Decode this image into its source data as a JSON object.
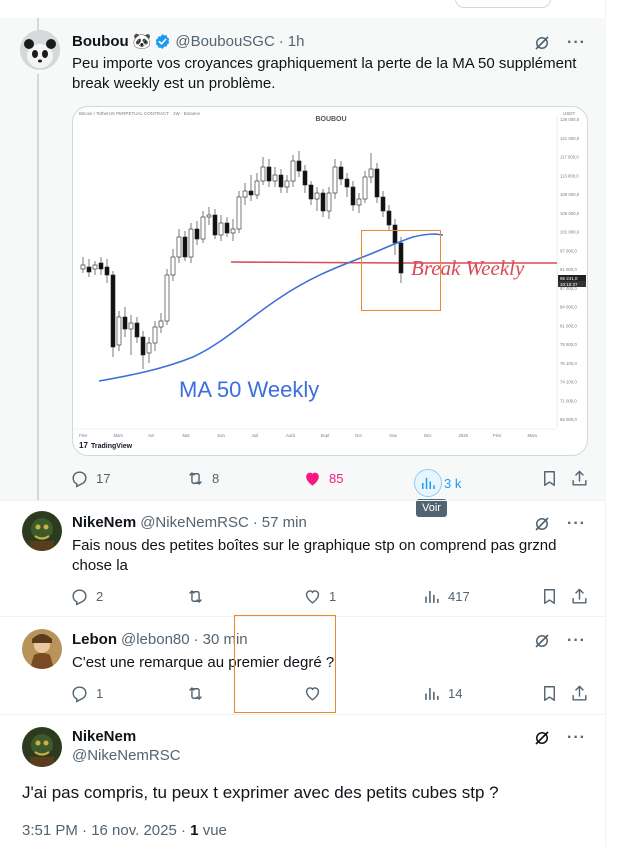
{
  "colors": {
    "text": "#0f1419",
    "muted": "#536471",
    "verified": "#1d9bf0",
    "like_active": "#f91880",
    "highlight_bg": "#f7f9f9",
    "annotation": "#e8892b",
    "ma_line": "#3b6fdc",
    "break_line": "#d94b55"
  },
  "post1": {
    "name": "Boubou",
    "emoji": "🐼",
    "handle": "@BoubouSGC",
    "sep": "·",
    "time": "1h",
    "text": "Peu importe vos croyances graphiquement la perte de la MA 50 supplément break weekly est un problème.",
    "stats": {
      "replies": "17",
      "reposts": "8",
      "likes": "85",
      "views": "3 k"
    },
    "views_tooltip": "Voir",
    "chart": {
      "header": "Bitcoin / TetherUS PERPETUAL CONTRACT · 1W · Binance",
      "watermark": "BOUBOU",
      "price_unit": "USDT",
      "price_ticks": [
        "126 000,0",
        "121 000,0",
        "117 000,0",
        "113 000,0",
        "109 000,0",
        "105 000,0",
        "101 000,0",
        "97 000,0",
        "91 000,0",
        "87 000,0",
        "84 000,0",
        "81 000,0",
        "78 500,0",
        "76 100,0",
        "74 100,0",
        "71 000,0",
        "68 000,0"
      ],
      "price_label": "95 241,0",
      "time_label": "10:10:37",
      "months": [
        "Févr",
        "Mars",
        "Avr",
        "Mai",
        "Juin",
        "Juil",
        "Août",
        "Sept",
        "Oct",
        "Nov",
        "Déc",
        "2026",
        "Févr",
        "Mars"
      ],
      "label_break": "Break Weekly",
      "label_ma": "MA 50 Weekly",
      "brand": "TradingView",
      "chart_type": "candlestick"
    }
  },
  "post2": {
    "name": "NikeNem",
    "handle": "@NikeNemRSC",
    "sep": "·",
    "time": "57 min",
    "text": "Fais nous des petites boîtes sur le graphique stp on comprend pas grznd chose la",
    "stats": {
      "replies": "2",
      "reposts": "",
      "likes": "1",
      "views": "417"
    }
  },
  "post3": {
    "name": "Lebon",
    "handle": "@lebon80",
    "sep": "·",
    "time": "30 min",
    "text": "C'est une remarque au premier degré ?",
    "stats": {
      "replies": "1",
      "reposts": "",
      "likes": "",
      "views": "14"
    }
  },
  "post4": {
    "name": "NikeNem",
    "handle": "@NikeNemRSC",
    "text": "J'ai pas compris, tu peux t exprimer avec des petits cubes stp ?",
    "date": "3:51 PM · 16 nov. 2025",
    "sep": "·",
    "views_count": "1",
    "views_label": "vue"
  }
}
